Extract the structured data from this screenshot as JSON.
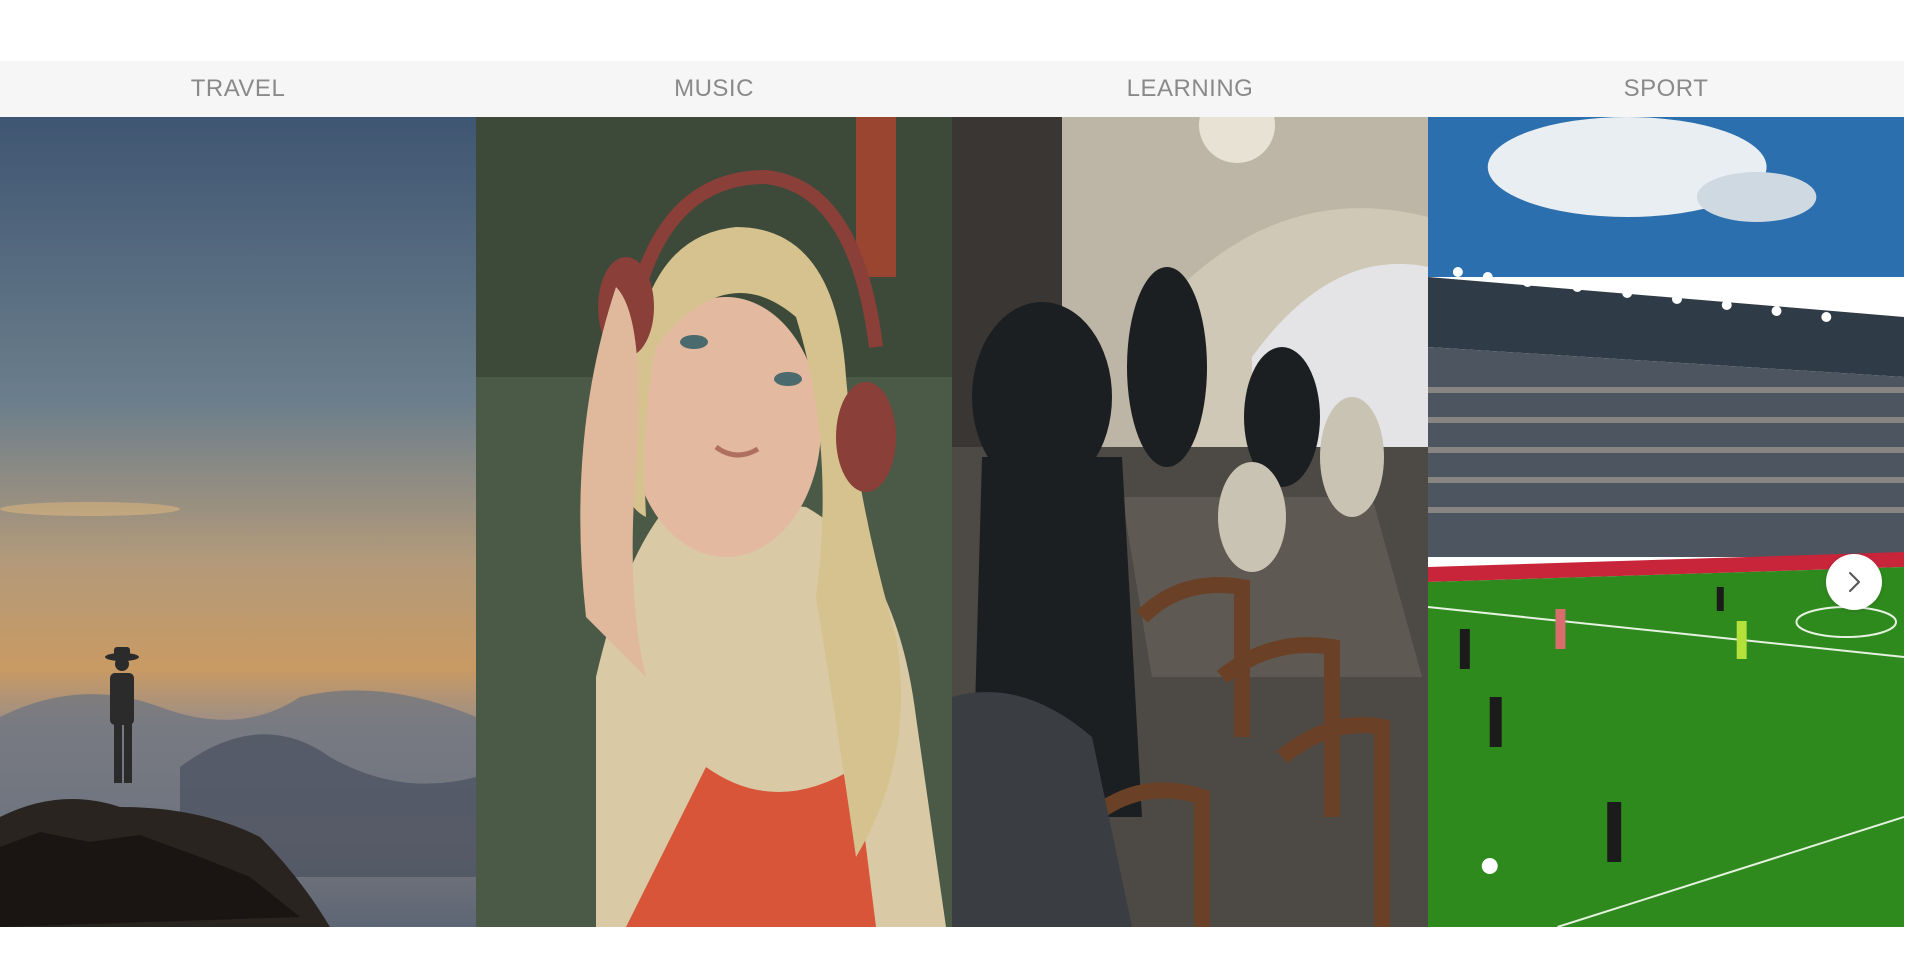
{
  "carousel": {
    "items": [
      {
        "label": "TRAVEL",
        "image": "mountain-summit-photo"
      },
      {
        "label": "MUSIC",
        "image": "woman-headphones-photo"
      },
      {
        "label": "LEARNING",
        "image": "people-library-photo"
      },
      {
        "label": "SPORT",
        "image": "football-stadium-photo"
      }
    ],
    "next_icon": "chevron-right-icon"
  },
  "colors": {
    "label_bg": "#f6f6f6",
    "label_text": "#8a8a8a",
    "pitch_green": "#2f8a1e",
    "sky_blue": "#2c6fae"
  }
}
